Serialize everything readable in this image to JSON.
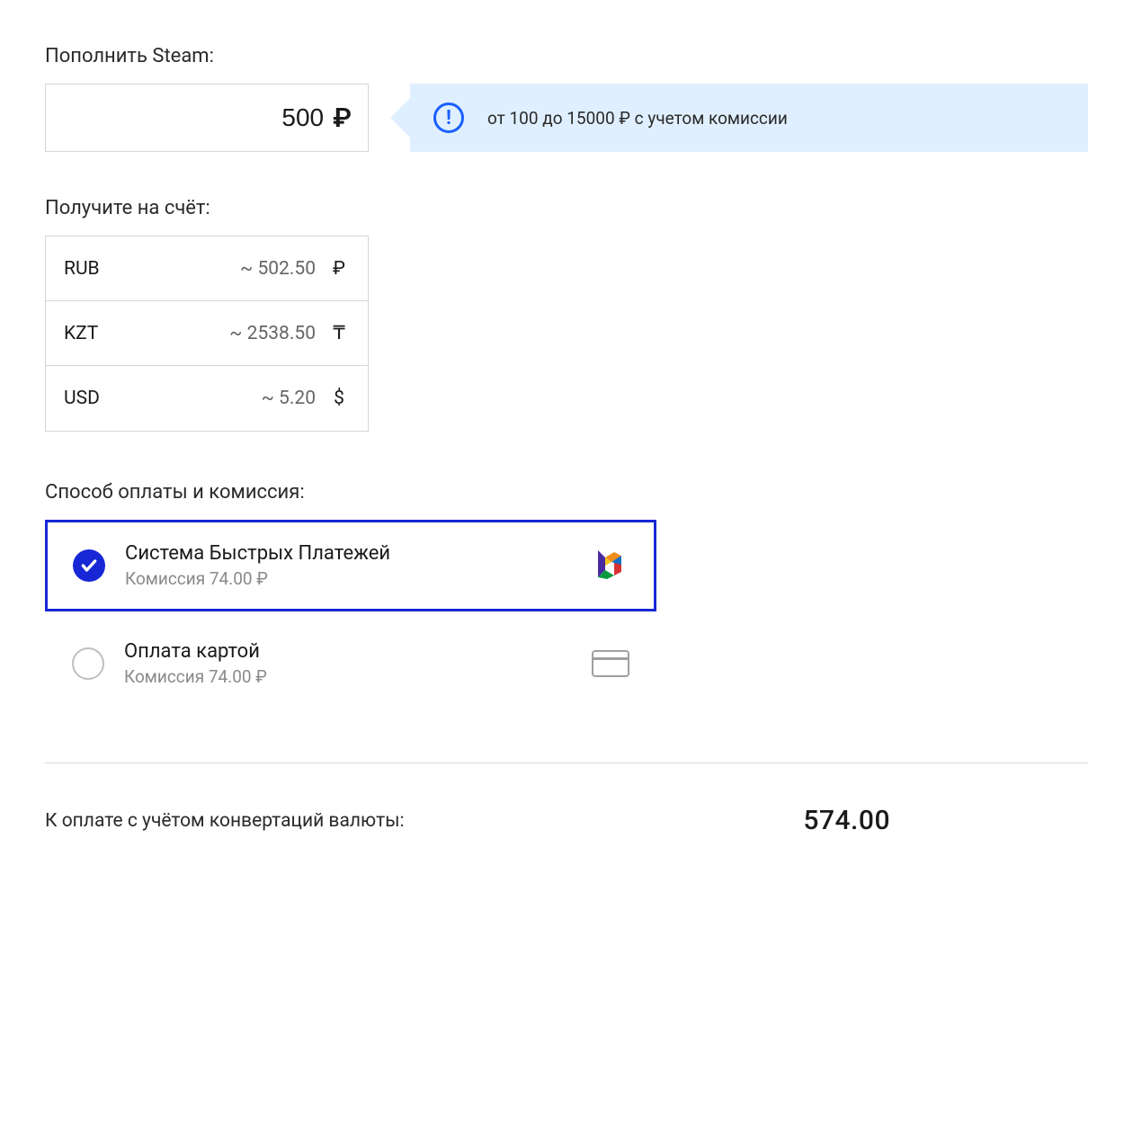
{
  "topup": {
    "label": "Пополнить Steam:",
    "value": "500",
    "currency_symbol": "₽",
    "hint": "от 100 до 15000 ₽ с учетом комиссии"
  },
  "receive": {
    "label": "Получите на счёт:",
    "rows": [
      {
        "code": "RUB",
        "value": "~ 502.50",
        "symbol": "₽"
      },
      {
        "code": "KZT",
        "value": "~ 2538.50",
        "symbol": "₸"
      },
      {
        "code": "USD",
        "value": "~ 5.20",
        "symbol": "$"
      }
    ]
  },
  "payment": {
    "label": "Способ оплаты и комиссия:",
    "options": [
      {
        "name": "Система Быстрых Платежей",
        "fee": "Комиссия 74.00 ₽",
        "icon": "sbp",
        "selected": true
      },
      {
        "name": "Оплата картой",
        "fee": "Комиссия 74.00 ₽",
        "icon": "card",
        "selected": false
      }
    ]
  },
  "total": {
    "label": "К оплате с учётом конвертаций валюты:",
    "value": "574.00"
  }
}
